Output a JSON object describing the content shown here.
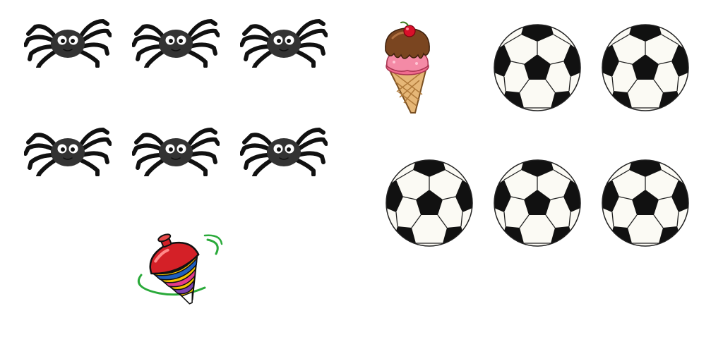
{
  "left_group": {
    "spider_count": 6,
    "spinning_top_count": 1
  },
  "right_group": {
    "ice_cream_count": 1,
    "soccer_ball_count": 5
  },
  "colors": {
    "background": "#ffffff",
    "spider_body": "#333333",
    "spider_legs": "#111111",
    "ball_black": "#111111",
    "ball_white": "#fbfaf4",
    "top_red": "#d42027",
    "top_yellow": "#f5c400",
    "top_blue": "#1f5fbf",
    "top_orbit": "#2aaa3a",
    "cone": "#e6b777",
    "strawberry": "#f06b8e",
    "chocolate": "#7a4520",
    "cherry": "#d9102a"
  }
}
